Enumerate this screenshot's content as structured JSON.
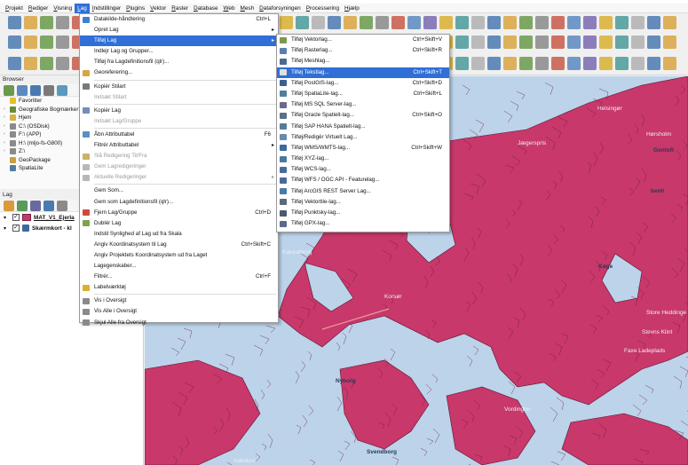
{
  "menubar": {
    "items": [
      "Projekt",
      "Rediger",
      "Visning",
      "Lag",
      "Indstillinger",
      "Plugins",
      "Vektor",
      "Raster",
      "Database",
      "Web",
      "Mesh",
      "Dataforsyningen",
      "Processering",
      "Hjælp"
    ],
    "active_index": 3
  },
  "lag_menu": {
    "items": [
      {
        "label": "Datakilde-håndtering",
        "shortcut": "Ctrl+L",
        "icon": "datasource-manager-icon",
        "color": "#3f7fd1"
      },
      {
        "label": "Opret Lag",
        "submenu": true
      },
      {
        "label": "Tilføj Lag",
        "submenu": true,
        "highlighted": true
      },
      {
        "label": "Indlejr Lag og Grupper..."
      },
      {
        "label": "Tilføj fra Lagdefinitionsfil (qlr)..."
      },
      {
        "label": "Georeferering...",
        "icon": "georeferencer-icon",
        "color": "#d9a441"
      },
      {
        "sep": true
      },
      {
        "label": "Kopiér Stilart",
        "icon": "copy-style-icon",
        "color": "#7a7a7a"
      },
      {
        "label": "Indsæt Stilart",
        "disabled": true
      },
      {
        "sep": true
      },
      {
        "label": "Kopiér Lag",
        "icon": "copy-layer-icon",
        "color": "#6f8fb8"
      },
      {
        "label": "Indsæt Lag/Gruppe",
        "disabled": true
      },
      {
        "sep": true
      },
      {
        "label": "Åbn Attributtabel",
        "shortcut": "F6",
        "icon": "attribute-table-icon",
        "color": "#5b8fc7"
      },
      {
        "label": "Filtrér Attributtabel",
        "submenu": true
      },
      {
        "label": "Slå Redigering Til/Fra",
        "disabled": true,
        "icon": "toggle-editing-icon",
        "color": "#c9b26a"
      },
      {
        "label": "Gem Lagredigeringer",
        "disabled": true,
        "icon": "save-edits-icon",
        "color": "#b8b8b8"
      },
      {
        "label": "Aktuelle Redigeringer",
        "disabled": true,
        "submenu": true,
        "icon": "current-edits-icon",
        "color": "#b8b8b8"
      },
      {
        "sep": true
      },
      {
        "label": "Gem Som..."
      },
      {
        "label": "Gem som Lagdefinitionsfil (qlr)..."
      },
      {
        "label": "Fjern Lag/Gruppe",
        "shortcut": "Ctrl+D",
        "icon": "remove-layer-icon",
        "color": "#d04a3a"
      },
      {
        "label": "Dublér Lag",
        "icon": "duplicate-layer-icon",
        "color": "#7fa34a"
      },
      {
        "label": "Indstil Synlighed af Lag ud fra Skala"
      },
      {
        "label": "Angiv Koordinatsystem til Lag",
        "shortcut": "Ctrl+Skift+C"
      },
      {
        "label": "Angiv Projektets Koordinatsystem ud fra Laget"
      },
      {
        "label": "Lagegenskaber..."
      },
      {
        "label": "Filtrér...",
        "shortcut": "Ctrl+F"
      },
      {
        "label": "Labelværktøj",
        "icon": "label-toolbar-icon",
        "color": "#d9b030"
      },
      {
        "sep": true
      },
      {
        "label": "Vis i Oversigt",
        "icon": "show-overview-icon",
        "color": "#8a8a8a"
      },
      {
        "label": "Vis Alle i Oversigt",
        "icon": "show-all-overview-icon",
        "color": "#8a8a8a"
      },
      {
        "label": "Skjul Alle fra Oversigt",
        "icon": "hide-all-overview-icon",
        "color": "#8a8a8a"
      }
    ]
  },
  "tilfoej_menu": {
    "items": [
      {
        "label": "Tilføj Vektorlag...",
        "shortcut": "Ctrl+Skift+V",
        "icon": "vector-layer-icon",
        "color": "#7c9a4a"
      },
      {
        "label": "Tilføj Rasterlag...",
        "shortcut": "Ctrl+Skift+R",
        "icon": "raster-layer-icon",
        "color": "#5a7fae"
      },
      {
        "label": "Tilføj Meshlag...",
        "icon": "mesh-layer-icon",
        "color": "#4b6a8e"
      },
      {
        "label": "Tilføj Tekstlag...",
        "shortcut": "Ctrl+Skift+T",
        "highlighted": true,
        "icon": "delimited-text-icon",
        "color": "#e0e0e0"
      },
      {
        "label": "Tilføj PostGIS-lag...",
        "shortcut": "Ctrl+Skift+D",
        "icon": "postgis-icon",
        "color": "#3a5f8f"
      },
      {
        "label": "Tilføj SpatiaLite-lag...",
        "shortcut": "Ctrl+Skift+L",
        "icon": "spatialite-icon",
        "color": "#4f7f9f"
      },
      {
        "label": "Tilføj MS SQL Server-lag...",
        "icon": "mssql-icon",
        "color": "#6a6a8a"
      },
      {
        "label": "Tilføj Oracle Spatielt-lag...",
        "shortcut": "Ctrl+Skift+O",
        "icon": "oracle-icon",
        "color": "#5a6f8a"
      },
      {
        "label": "Tilføj SAP HANA Spatielt-lag...",
        "icon": "sap-hana-icon",
        "color": "#5a7a9a"
      },
      {
        "label": "Tilføj/Redigér Virtuelt Lag...",
        "icon": "virtual-layer-icon",
        "color": "#6a8aaa"
      },
      {
        "label": "Tilføj WMS/WMTS-lag...",
        "shortcut": "Ctrl+Skift+W",
        "icon": "wms-icon",
        "color": "#3a6aa0"
      },
      {
        "label": "Tilføj XYZ-lag...",
        "icon": "xyz-icon",
        "color": "#4a7a9a"
      },
      {
        "label": "Tilføj WCS-lag...",
        "icon": "wcs-icon",
        "color": "#4a6a9a"
      },
      {
        "label": "Tilføj WFS / OGC API - Featurelag...",
        "icon": "wfs-icon",
        "color": "#4a6a9a"
      },
      {
        "label": "Tilføj ArcGIS REST Server Lag...",
        "icon": "arcgis-icon",
        "color": "#4a7aaa"
      },
      {
        "label": "Tilføj Vektortile-lag...",
        "icon": "vector-tile-icon",
        "color": "#5a6a7a"
      },
      {
        "label": "Tilføj Punktsky-lag...",
        "icon": "point-cloud-icon",
        "color": "#4a5a6a"
      },
      {
        "label": "Tilføj GPX-lag...",
        "icon": "gpx-icon",
        "color": "#5a6a8a"
      }
    ]
  },
  "browser": {
    "title": "Browser",
    "items": [
      {
        "label": "Favoritter",
        "icon": "star-icon",
        "color": "#e6c02a",
        "arrow": ""
      },
      {
        "label": "Geografiske Bogmærker",
        "icon": "bookmark-icon",
        "color": "#6a8a3a",
        "arrow": "›"
      },
      {
        "label": "Hjem",
        "icon": "home-folder-icon",
        "color": "#d8b04a",
        "arrow": "›"
      },
      {
        "label": "C:\\ (OSDisk)",
        "icon": "drive-icon",
        "color": "#8a8a8a",
        "arrow": "›"
      },
      {
        "label": "F:\\ (APP)",
        "icon": "drive-icon",
        "color": "#8a8a8a",
        "arrow": "›"
      },
      {
        "label": "H:\\ (mljo-fs-G800)",
        "icon": "network-drive-icon",
        "color": "#8a8a8a",
        "arrow": "›"
      },
      {
        "label": "Z:\\",
        "icon": "drive-icon",
        "color": "#8a8a8a",
        "arrow": "›"
      },
      {
        "label": "GeoPackage",
        "icon": "geopackage-icon",
        "color": "#c8a040",
        "arrow": ""
      },
      {
        "label": "SpatiaLite",
        "icon": "spatialite-icon",
        "color": "#4f7f9f",
        "arrow": ""
      }
    ]
  },
  "layers": {
    "title": "Lag",
    "items": [
      {
        "label": "MAT_V1_Ejerla",
        "checked": true,
        "swatch": "#c8386a"
      },
      {
        "label": "Skærmkort - kl",
        "checked": true,
        "swatch": ""
      }
    ]
  },
  "map": {
    "land_color": "#c8386a",
    "water_color": "#bcd3ea",
    "places": [
      {
        "label": "Helsingør",
        "dark": false
      },
      {
        "label": "Jægerspris",
        "dark": false
      },
      {
        "label": "Hørsholm",
        "dark": false
      },
      {
        "label": "Gentoft",
        "dark": true
      },
      {
        "label": "benh",
        "dark": true
      },
      {
        "label": "Køge",
        "dark": true
      },
      {
        "label": "Kalundborg",
        "dark": false
      },
      {
        "label": "Korsør",
        "dark": false
      },
      {
        "label": "Nyborg",
        "dark": true
      },
      {
        "label": "Vordingbo",
        "dark": false
      },
      {
        "label": "Faxe Ladeplads",
        "dark": false
      },
      {
        "label": "Store Heddinge",
        "dark": false
      },
      {
        "label": "Stevns Klint",
        "dark": false
      },
      {
        "label": "Svendborg",
        "dark": true
      },
      {
        "label": "Nakskov",
        "dark": false
      }
    ]
  }
}
